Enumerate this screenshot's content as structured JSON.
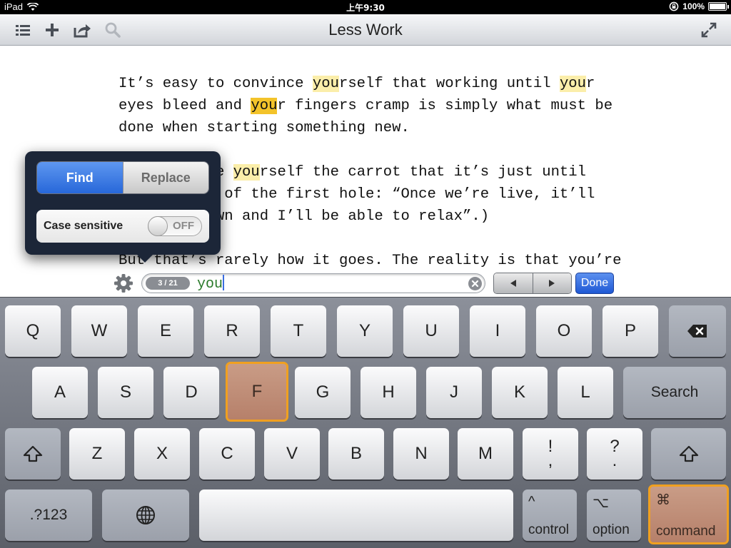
{
  "status": {
    "device": "iPad",
    "time": "上午9:30",
    "battery": "100%",
    "battery_level": 1.0
  },
  "toolbar": {
    "title": "Less Work",
    "icons": [
      "list-icon",
      "plus-icon",
      "share-icon",
      "search-icon",
      "expand-icon"
    ]
  },
  "document": {
    "lines": [
      [
        {
          "t": "It’s easy to convince "
        },
        {
          "t": "you",
          "hl": 1
        },
        {
          "t": "rself that working until "
        },
        {
          "t": "you",
          "hl": 1
        },
        {
          "t": "r"
        }
      ],
      [
        {
          "t": "eyes bleed and "
        },
        {
          "t": "you",
          "hl": 2
        },
        {
          "t": "r fingers cramp is simply what must be"
        }
      ],
      [
        {
          "t": "done when starting something new."
        }
      ],
      [
        {
          "t": ""
        }
      ],
      [
        {
          "t": "(It's simple "
        },
        {
          "t": "you",
          "hl": 1
        },
        {
          "t": "rself the carrot that it’s just until"
        }
      ],
      [
        {
          "t": "you get out of the first hole: “Once we’re live, it’ll"
        }
      ],
      [
        {
          "t": "all calm down and I’ll be able to relax”.)"
        }
      ],
      [
        {
          "t": ""
        }
      ],
      [
        {
          "t": "But that’s rarely how it goes. The reality is that you’re"
        }
      ]
    ]
  },
  "popover": {
    "find_label": "Find",
    "replace_label": "Replace",
    "case_label": "Case sensitive",
    "case_value": "OFF"
  },
  "search": {
    "counter": "3 / 21",
    "query": "you",
    "done_label": "Done"
  },
  "keyboard": {
    "row1": [
      "Q",
      "W",
      "E",
      "R",
      "T",
      "Y",
      "U",
      "I",
      "O",
      "P"
    ],
    "row2": [
      "A",
      "S",
      "D",
      "F",
      "G",
      "H",
      "J",
      "K",
      "L"
    ],
    "search_label": "Search",
    "row3": [
      "Z",
      "X",
      "C",
      "V",
      "B",
      "N",
      "M"
    ],
    "excl_top": "!",
    "excl_bottom": ",",
    "quest_top": "?",
    "quest_bottom": ".",
    "numbers_label": ".?123",
    "control_symbol": "^",
    "control_label": "control",
    "option_symbol": "⌥",
    "option_label": "option",
    "command_symbol": "⌘",
    "command_label": "command"
  }
}
